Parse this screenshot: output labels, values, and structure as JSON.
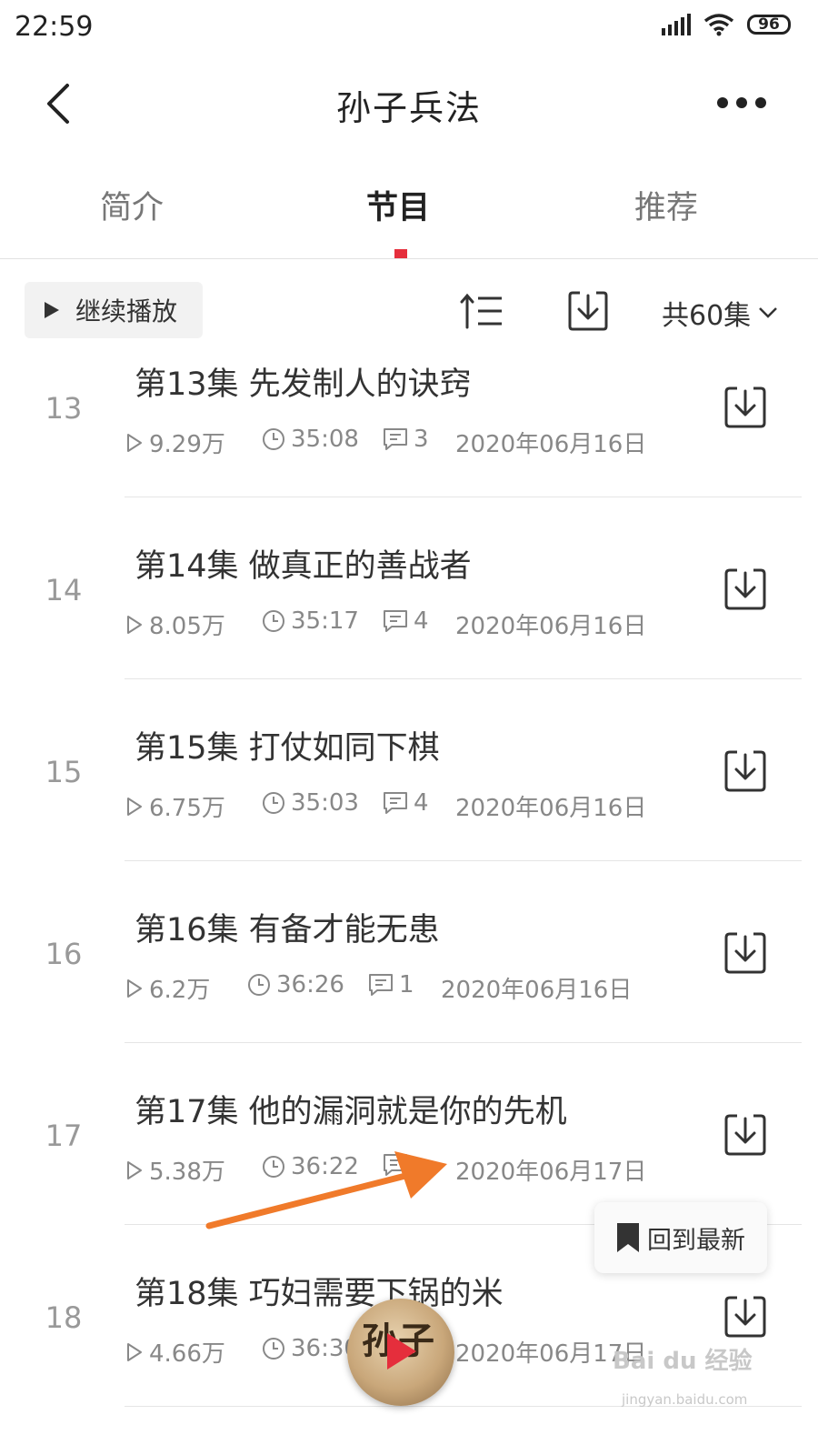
{
  "status": {
    "time": "22:59",
    "battery": "96"
  },
  "header": {
    "title": "孙子兵法"
  },
  "tabs": [
    {
      "label": "简介",
      "active": false
    },
    {
      "label": "节目",
      "active": true
    },
    {
      "label": "推荐",
      "active": false
    }
  ],
  "toolbar": {
    "continue_label": "继续播放",
    "episode_count": "共60集"
  },
  "episodes": [
    {
      "num": "13",
      "title": "第13集 先发制人的诀窍",
      "plays": "9.29万",
      "duration": "35:08",
      "comments": "3",
      "date": "2020年06月16日"
    },
    {
      "num": "14",
      "title": "第14集 做真正的善战者",
      "plays": "8.05万",
      "duration": "35:17",
      "comments": "4",
      "date": "2020年06月16日"
    },
    {
      "num": "15",
      "title": "第15集 打仗如同下棋",
      "plays": "6.75万",
      "duration": "35:03",
      "comments": "4",
      "date": "2020年06月16日"
    },
    {
      "num": "16",
      "title": "第16集 有备才能无患",
      "plays": "6.2万",
      "duration": "36:26",
      "comments": "1",
      "date": "2020年06月16日"
    },
    {
      "num": "17",
      "title": "第17集 他的漏洞就是你的先机",
      "plays": "5.38万",
      "duration": "36:22",
      "comments": "",
      "date": "2020年06月17日"
    },
    {
      "num": "18",
      "title": "第18集 巧妇需要下锅的米",
      "plays": "4.66万",
      "duration": "36:30",
      "comments": "",
      "date": "2020年06月17日"
    }
  ],
  "floating": {
    "latest_label": "回到最新",
    "player_cover_text": "孙子"
  },
  "watermark": {
    "main": "Bai du 经验",
    "sub": "jingyan.baidu.com"
  },
  "colors": {
    "accent": "#e52e3c",
    "arrow": "#f07a2a"
  }
}
